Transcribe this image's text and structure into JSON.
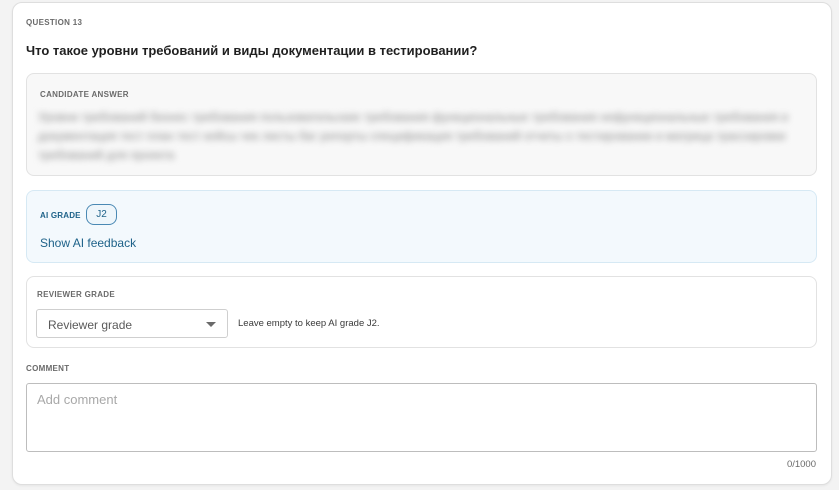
{
  "question": {
    "number_label": "QUESTION 13",
    "title": "Что такое уровни требований и виды документации в тестировании?"
  },
  "candidate_answer": {
    "label": "CANDIDATE ANSWER",
    "text": "Уровни требований бизнес требования пользовательские требования функциональные требования нефункциональные требования и документация тест план тест кейсы чек листы баг репорты спецификация требований отчеты о тестировании и матрица трассировки требований для проекта"
  },
  "ai_grade": {
    "label": "AI GRADE",
    "value": "J2",
    "feedback_link": "Show AI feedback"
  },
  "reviewer_grade": {
    "label": "REVIEWER GRADE",
    "select_value": "Reviewer grade",
    "hint": "Leave empty to keep AI grade J2."
  },
  "comment": {
    "label": "COMMENT",
    "placeholder": "Add comment",
    "value": "",
    "counter": "0/1000"
  },
  "colors": {
    "accent": "#1e6289",
    "ai_box_bg": "#f3f9fd",
    "answer_box_bg": "#f8f8f8"
  },
  "icons": {
    "select_caret": "caret-down-icon"
  }
}
